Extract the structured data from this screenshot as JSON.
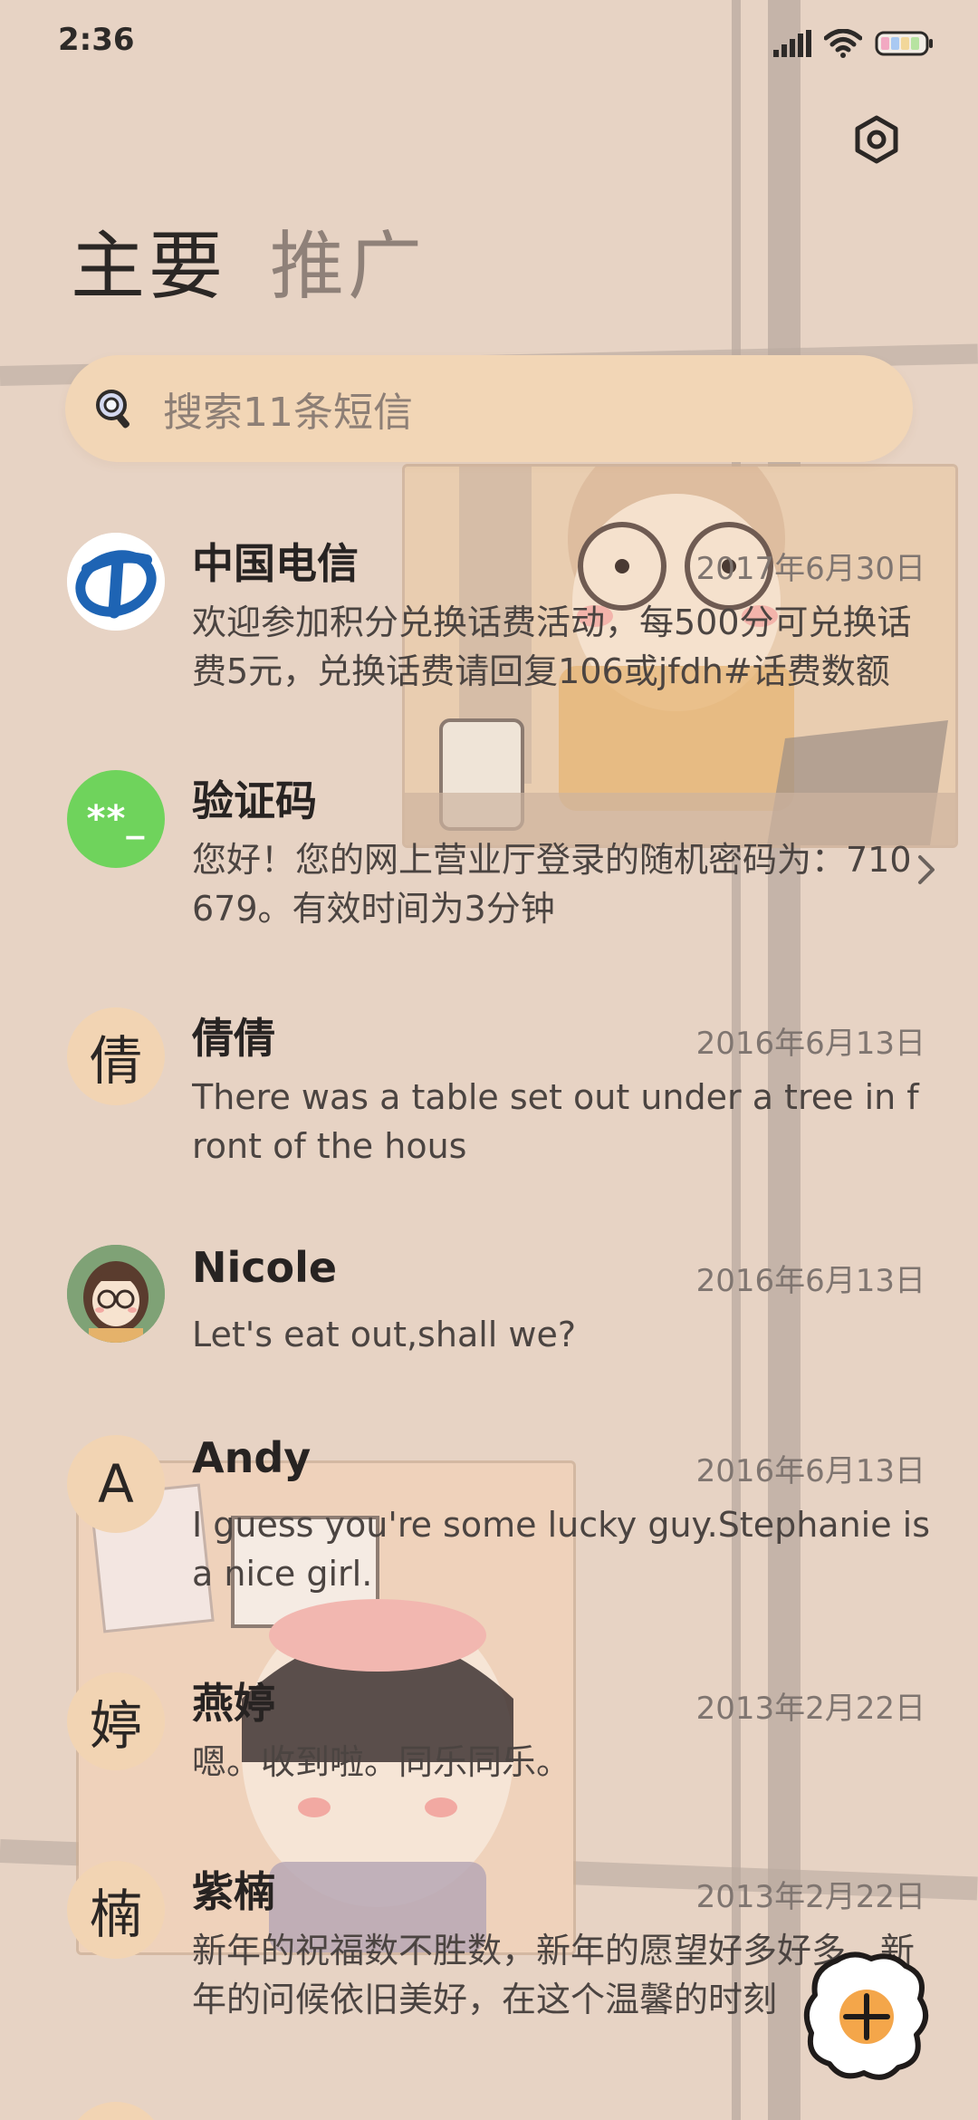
{
  "status_bar": {
    "time": "2:36",
    "icons": [
      "signal-icon",
      "wifi-icon",
      "battery-icon"
    ]
  },
  "header": {
    "settings_icon": "settings-icon",
    "tabs": [
      {
        "label": "主要",
        "active": true
      },
      {
        "label": "推广",
        "active": false
      }
    ]
  },
  "search": {
    "placeholder": "搜索11条短信",
    "icon": "search-icon"
  },
  "conversations": [
    {
      "name": "中国电信",
      "date": "2017年6月30日",
      "preview": "欢迎参加积分兑换话费活动，每500分可兑换话费5元，兑换话费请回复106或jfdh#话费数额",
      "avatar_type": "telecom-logo"
    },
    {
      "name": "验证码",
      "date": "",
      "preview": "您好！您的网上营业厅登录的随机密码为：710679。有效时间为3分钟",
      "avatar_type": "captcha",
      "avatar_text": "**_"
    },
    {
      "name": "倩倩",
      "date": "2016年6月13日",
      "preview": "There was a table set out under a tree in front of the hous",
      "avatar_type": "letter",
      "avatar_text": "倩"
    },
    {
      "name": "Nicole",
      "date": "2016年6月13日",
      "preview": "Let's eat out,shall we?",
      "avatar_type": "photo"
    },
    {
      "name": "Andy",
      "date": "2016年6月13日",
      "preview": "I guess you're some lucky guy.Stephanie is a nice girl.",
      "avatar_type": "letter",
      "avatar_text": "A"
    },
    {
      "name": "燕婷",
      "date": "2013年2月22日",
      "preview": "嗯。收到啦。同乐同乐。",
      "avatar_type": "letter",
      "avatar_text": "婷"
    },
    {
      "name": "紫楠",
      "date": "2013年2月22日",
      "preview": "新年的祝福数不胜数，新年的愿望好多好多，新年的问候依旧美好，在这个温馨的时刻",
      "avatar_type": "letter",
      "avatar_text": "楠"
    }
  ],
  "fab": {
    "icon": "plus-icon"
  },
  "colors": {
    "background": "#e7d3c4",
    "search_bar": "#f2d6b6",
    "captcha_avatar": "#6fd35c",
    "letter_avatar": "#f2d4b3",
    "telecom_blue": "#1e64b4",
    "fab_fill": "#f4a64a"
  }
}
